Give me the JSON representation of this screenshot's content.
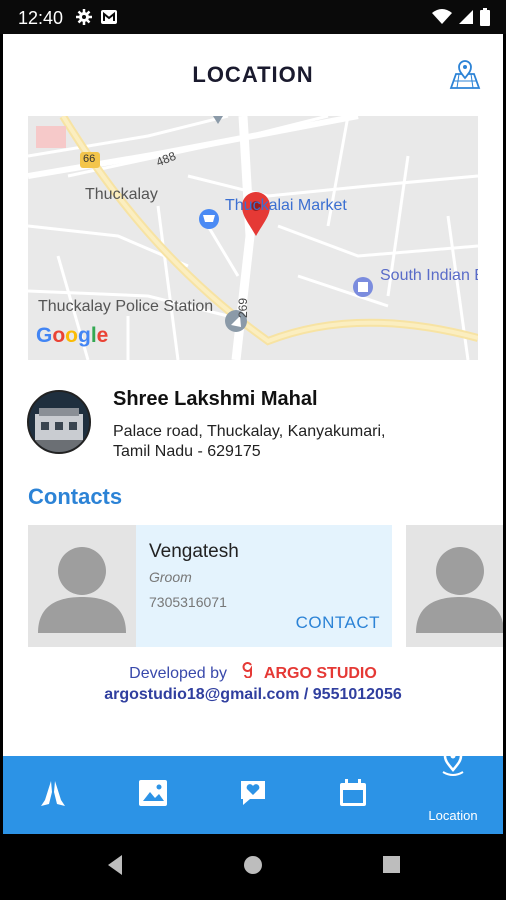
{
  "status_bar": {
    "time": "12:40"
  },
  "header": {
    "title": "LOCATION"
  },
  "map": {
    "labels": {
      "road_66": "66",
      "road_488": "488",
      "road_269": "269",
      "thuckalay": "Thuckalay",
      "market": "Thuckalai Market",
      "south_indian": "South Indian B",
      "police": "Thuckalay Police Station"
    },
    "google": "Google"
  },
  "venue": {
    "name": "Shree Lakshmi Mahal",
    "address": "Palace road, Thuckalay, Kanyakumari, Tamil Nadu - 629175"
  },
  "contacts": {
    "title": "Contacts",
    "items": [
      {
        "name": "Vengatesh",
        "role": "Groom",
        "phone": "7305316071",
        "action": "CONTACT"
      }
    ]
  },
  "footer": {
    "developed_by": "Developed by",
    "studio": "ARGO STUDIO",
    "contact": "argostudio18@gmail.com / 9551012056"
  },
  "bottom_nav": {
    "location_label": "Location"
  },
  "colors": {
    "accent": "#2c93e6",
    "contact_blue": "#2c83d6",
    "studio_red": "#e53935"
  }
}
